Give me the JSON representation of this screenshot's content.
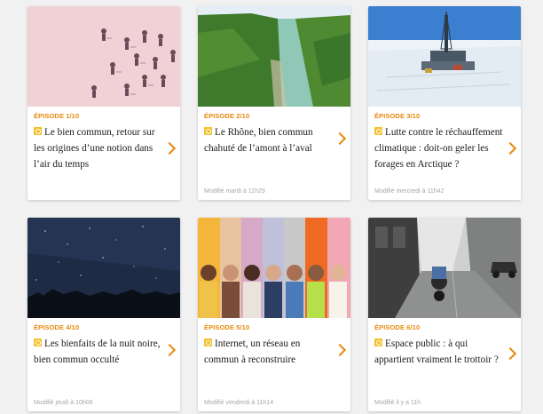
{
  "cards": [
    {
      "episode": "ÉPISODE 1/10",
      "title": "Le bien commun, retour sur les origines d’une notion dans l’air du temps",
      "meta": ""
    },
    {
      "episode": "ÉPISODE 2/10",
      "title": "Le Rhône, bien commun chahuté de l’amont à l’aval",
      "meta": "Modifié mardi à 11h29"
    },
    {
      "episode": "ÉPISODE 3/10",
      "title": "Lutte contre le réchauffement climatique : doit-on geler les forages en Arctique ?",
      "meta": "Modifié mercredi à 11h42"
    },
    {
      "episode": "ÉPISODE 4/10",
      "title": "Les bienfaits de la nuit noire, bien commun occulté",
      "meta": "Modifié jeudi à 10h08"
    },
    {
      "episode": "ÉPISODE 5/10",
      "title": "Internet, un réseau en commun à reconstruire",
      "meta": "Modifié vendredi à 11h14"
    },
    {
      "episode": "ÉPISODE 6/10",
      "title": "Espace public : à qui appartient vraiment le trottoir ?",
      "meta": "Modifié il y a 11h"
    }
  ],
  "icons": {
    "badge": "audio-badge-icon",
    "chevron": "chevron-right-icon"
  },
  "colors": {
    "accent": "#e8890c",
    "badge": "#f2c12e",
    "meta": "#a7a7a7"
  }
}
